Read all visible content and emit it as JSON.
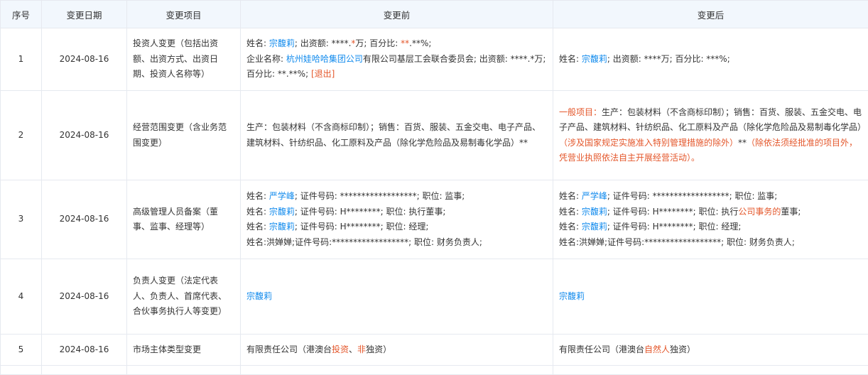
{
  "headers": {
    "seq": "序号",
    "date": "变更日期",
    "item": "变更项目",
    "before": "变更前",
    "after": "变更后"
  },
  "rows": [
    {
      "seq": "1",
      "date": "2024-08-16",
      "item": "投资人变更（包括出资额、出资方式、出资日期、投资人名称等）",
      "before": {
        "l1_a": "姓名: ",
        "l1_name": "宗馥莉",
        "l1_b": "; 出资额: ****.",
        "l1_star": "*",
        "l1_c": "万; 百分比: ",
        "l1_pct": "**",
        "l1_d": ".**%;",
        "l2_a": "企业名称: ",
        "l2_company": "杭州娃哈哈集团公司",
        "l2_b": "有限公司基层工会联合委员会; 出资额: ****.*万; 百分比: **.**%; ",
        "l2_exit": "[退出]"
      },
      "after": {
        "a": "姓名: ",
        "name": "宗馥莉",
        "b": "; 出资额: ****万; 百分比: ***%;"
      }
    },
    {
      "seq": "2",
      "date": "2024-08-16",
      "item": "经营范围变更（含业务范围变更）",
      "before": {
        "text": "生产：包装材料（不含商标印制）；销售：百货、服装、五金交电、电子产品、建筑材料、针纺织品、化工原料及产品（除化学危险品及易制毒化学品）**"
      },
      "after": {
        "r1": "一般项目：",
        "t1": "生产：包装材料（不含商标印制）；销售：百货、服装、五金交电、电子产品、建筑材料、针纺织品、化工原料及产品（除化学危险品及易制毒化学品）",
        "r2": "（涉及国家规定实施准入特别管理措施的除外）",
        "t2": "**",
        "r3": "（除依法须经批准的项目外，凭营业执照依法自主开展经营活动）。"
      }
    },
    {
      "seq": "3",
      "date": "2024-08-16",
      "item": "高级管理人员备案（董事、监事、经理等）",
      "before": {
        "l1_a": "姓名: ",
        "l1_name": "严学峰",
        "l1_b": "; 证件号码: ******************; 职位: 监事;",
        "l2_a": "姓名: ",
        "l2_name": "宗馥莉",
        "l2_b": "; 证件号码: H********; 职位: 执行董事;",
        "l3_a": "姓名: ",
        "l3_name": "宗馥莉",
        "l3_b": "; 证件号码: H********; 职位: 经理;",
        "l4": "姓名:洪婵婵;证件号码:******************; 职位: 财务负责人;"
      },
      "after": {
        "l1_a": "姓名: ",
        "l1_name": "严学峰",
        "l1_b": "; 证件号码: ******************; 职位: 监事;",
        "l2_a": "姓名: ",
        "l2_name": "宗馥莉",
        "l2_b": "; 证件号码: H********; 职位: 执行",
        "l2_red": "公司事务的",
        "l2_c": "董事;",
        "l3_a": "姓名: ",
        "l3_name": "宗馥莉",
        "l3_b": "; 证件号码: H********; 职位: 经理;",
        "l4": "姓名:洪婵婵;证件号码:******************; 职位: 财务负责人;"
      }
    },
    {
      "seq": "4",
      "date": "2024-08-16",
      "item": "负责人变更（法定代表人、负责人、首席代表、合伙事务执行人等变更）",
      "before": {
        "name": "宗馥莉"
      },
      "after": {
        "name": "宗馥莉"
      }
    },
    {
      "seq": "5",
      "date": "2024-08-16",
      "item": "市场主体类型变更",
      "before": {
        "a": "有限责任公司（港澳台",
        "r1": "投资",
        "b": "、",
        "r2": "非",
        "c": "独资）"
      },
      "after": {
        "a": "有限责任公司（港澳台",
        "r1": "自然人",
        "b": "独资）"
      }
    }
  ],
  "colors": {
    "link": "#128bed",
    "highlight": "#e4572b",
    "header_bg": "#f2f7fd",
    "border": "#e6e9f0"
  }
}
